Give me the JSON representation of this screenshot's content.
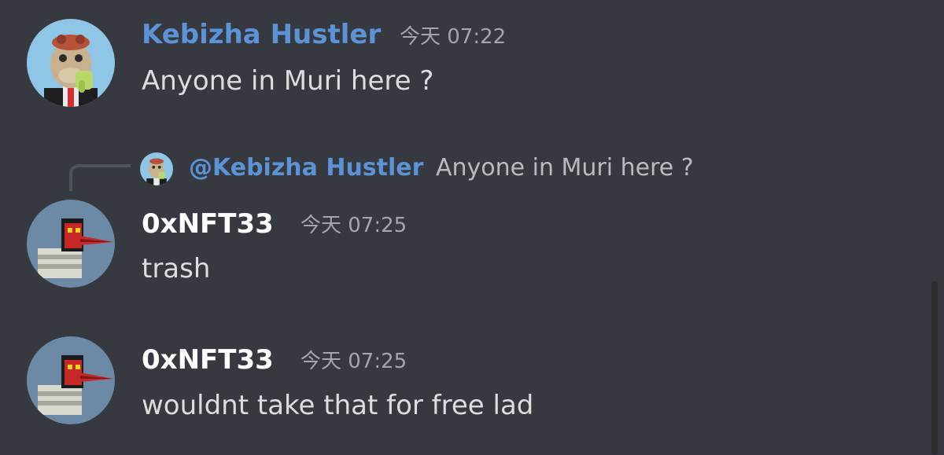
{
  "colors": {
    "background": "#36393f",
    "username_blue": "#5c93d6",
    "username_white": "#ffffff",
    "text": "#dcddde",
    "muted": "#a3a6aa"
  },
  "messages": [
    {
      "author": "Kebizha Hustler",
      "timestamp": "今天 07:22",
      "content": "Anyone in Muri here ?",
      "avatar_icon": "ape-avatar-icon"
    },
    {
      "reply": {
        "mention": "@Kebizha Hustler",
        "text": "Anyone in Muri here ?",
        "avatar_icon": "ape-avatar-icon"
      },
      "author": "0xNFT33",
      "timestamp": "今天 07:25",
      "content": "trash",
      "avatar_icon": "masked-figure-avatar-icon"
    },
    {
      "author": "0xNFT33",
      "timestamp": "今天 07:25",
      "content": "wouldnt take that for free lad",
      "avatar_icon": "masked-figure-avatar-icon"
    }
  ]
}
